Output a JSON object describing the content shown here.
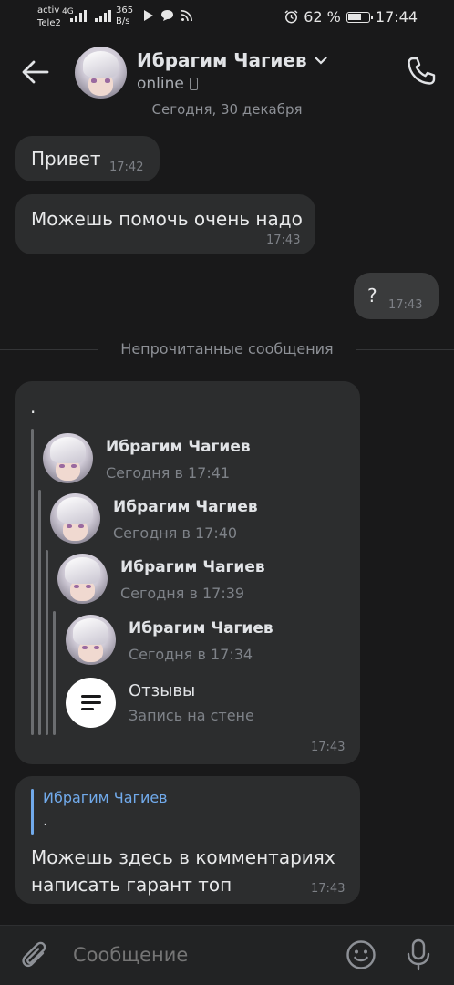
{
  "status_bar": {
    "carrier_line1": "activ",
    "carrier_line2": "Tele2",
    "network": "4G",
    "speed_value": "365",
    "speed_unit": "B/s",
    "battery_percent": "62 %",
    "time": "17:44"
  },
  "header": {
    "contact_name": "Ибрагим Чагиев",
    "status": "online"
  },
  "date_label": "Сегодня, 30 декабря",
  "messages": [
    {
      "text": "Привет",
      "time": "17:42"
    },
    {
      "text": "Можешь помочь очень надо",
      "time": "17:43"
    },
    {
      "text": "?",
      "time": "17:43"
    }
  ],
  "unread_divider": "Непрочитанные сообщения",
  "forwarded_message": {
    "text": ".",
    "time": "17:43",
    "chain": [
      {
        "name": "Ибрагим Чагиев",
        "time": "Сегодня в 17:41"
      },
      {
        "name": "Ибрагим Чагиев",
        "time": "Сегодня в 17:40"
      },
      {
        "name": "Ибрагим Чагиев",
        "time": "Сегодня в 17:39"
      },
      {
        "name": "Ибрагим Чагиев",
        "time": "Сегодня в 17:34"
      }
    ],
    "attachment": {
      "title": "Отзывы",
      "subtitle": "Запись на стене"
    }
  },
  "reply_message": {
    "quoted_author": "Ибрагим Чагиев",
    "quoted_text": ".",
    "text_line1": "Можешь здесь в комментариях",
    "text_line2": "написать гарант топ",
    "time": "17:43"
  },
  "composer": {
    "placeholder": "Сообщение"
  },
  "colors": {
    "background": "#19191a",
    "bubble_in": "#2c2d2e",
    "bubble_out": "#3a3b3c",
    "accent": "#71aaeb"
  }
}
